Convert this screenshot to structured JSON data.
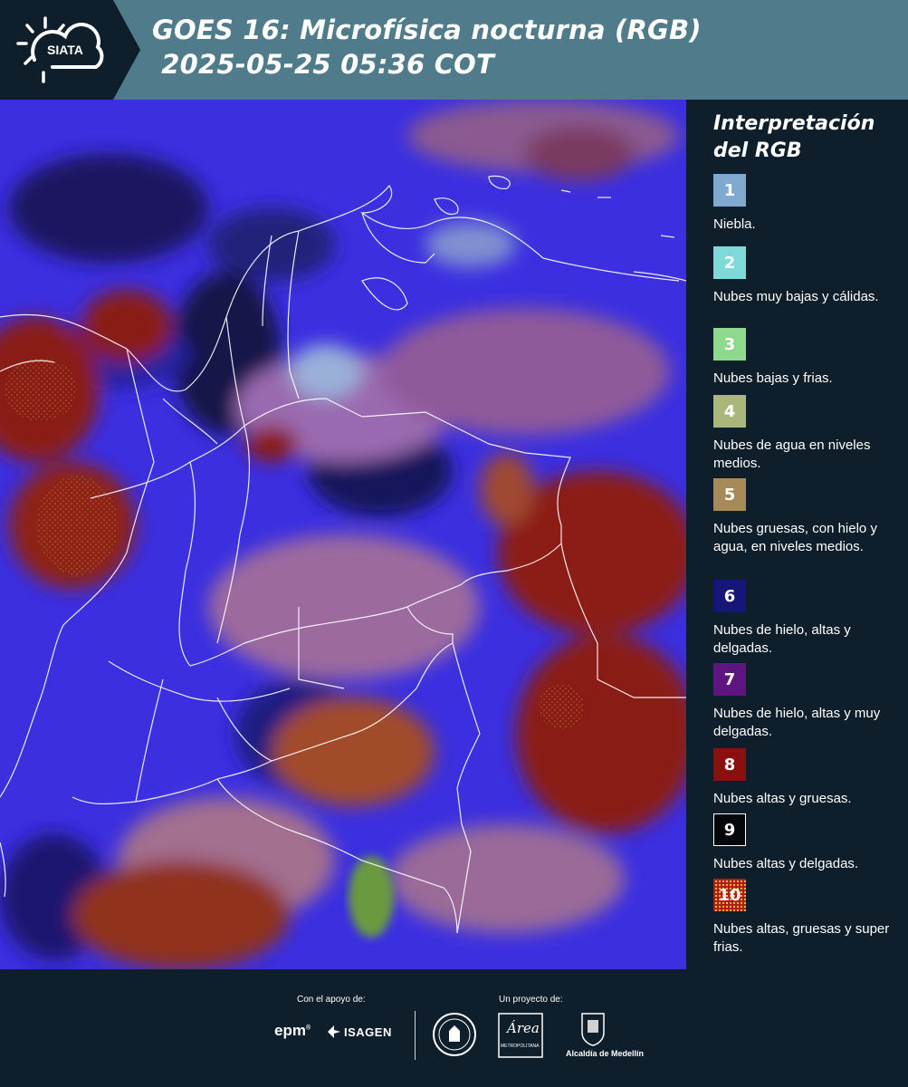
{
  "header": {
    "logo_text": "SIATA",
    "title_line1": "GOES 16: Microfísica nocturna (RGB)",
    "title_line2": " 2025-05-25 05:36 COT"
  },
  "legend": {
    "title": "Interpretación del RGB",
    "items": [
      {
        "number": "1",
        "label": "Niebla.",
        "color": "#7fa9cf"
      },
      {
        "number": "2",
        "label": "Nubes muy bajas y cálidas.",
        "color": "#7fd9d8"
      },
      {
        "number": "3",
        "label": "Nubes bajas y frias.",
        "color": "#8fd98c"
      },
      {
        "number": "4",
        "label": "Nubes de agua en niveles medios.",
        "color": "#a9b87a"
      },
      {
        "number": "5",
        "label": "Nubes gruesas, con hielo y agua, en niveles medios.",
        "color": "#a8895a"
      },
      {
        "number": "6",
        "label": "Nubes de hielo, altas y delgadas.",
        "color": "#15157a"
      },
      {
        "number": "7",
        "label": "Nubes de hielo, altas y muy delgadas.",
        "color": "#5e1580"
      },
      {
        "number": "8",
        "label": "Nubes altas y gruesas.",
        "color": "#8a1010"
      },
      {
        "number": "9",
        "label": "Nubes altas y delgadas.",
        "color": "#06070a"
      },
      {
        "number": "10",
        "label": "Nubes altas, gruesas y super frias.",
        "color": "#b01e10"
      }
    ]
  },
  "footer": {
    "support_label": "Con el apoyo de:",
    "project_label": "Un proyecto de:",
    "epm": "epm",
    "isagen": "ISAGEN",
    "area_logo_text": "Área",
    "area_logo_sub": "METROPOLITANA",
    "alcaldia": "Alcaldía de Medellín"
  },
  "colors": {
    "header_bg": "#4f7b8a",
    "panel_bg": "#0e1e2a",
    "map_base": "#3a2bd8"
  }
}
